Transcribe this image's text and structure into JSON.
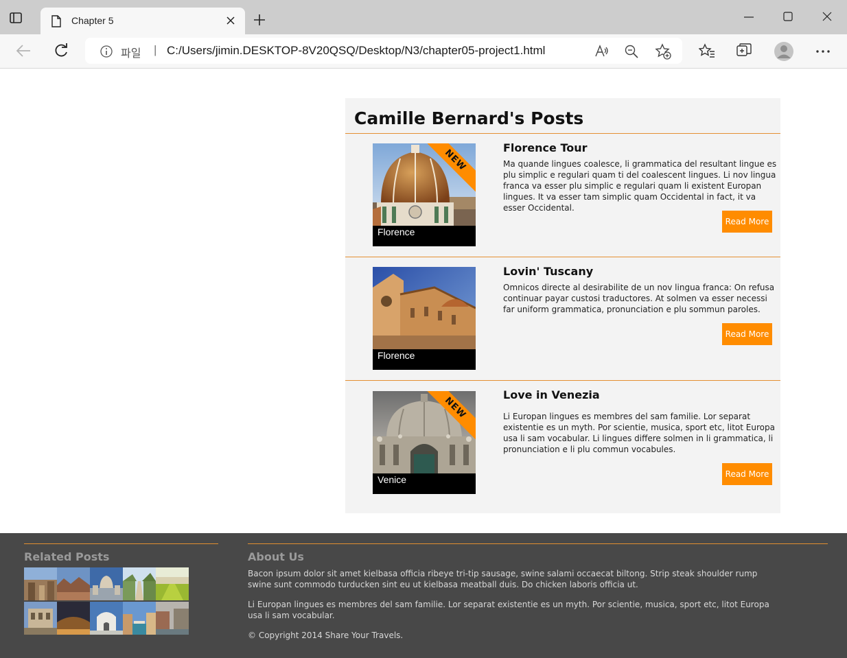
{
  "browser": {
    "tab_title": "Chapter 5",
    "address_prefix": "파일",
    "address_separator": "|",
    "url": "C:/Users/jimin.DESKTOP-8V20QSQ/Desktop/N3/chapter05-project1.html"
  },
  "posts": {
    "heading": "Camille Bernard's Posts",
    "items": [
      {
        "title": "Florence Tour",
        "text": "Ma quande lingues coalesce, li grammatica del resultant lingue es plu simplic e regulari quam ti del coalescent lingues. Li nov lingua franca va esser plu simplic e regulari quam li existent Europan lingues. It va esser tam simplic quam Occidental in fact, it va esser Occidental.",
        "caption": "Florence",
        "badge": "NEW",
        "button": "Read More"
      },
      {
        "title": "Lovin' Tuscany",
        "text": "Omnicos directe al desirabilite de un nov lingua franca: On refusa continuar payar custosi traductores. At solmen va esser necessi far uniform grammatica, pronunciation e plu sommun paroles.",
        "caption": "Florence",
        "button": "Read More"
      },
      {
        "title": "Love in Venezia",
        "text": "Li Europan lingues es membres del sam familie. Lor separat existentie es un myth. Por scientie, musica, sport etc, litot Europa usa li sam vocabular. Li lingues differe solmen in li grammatica, li pronunciation e li plu commun vocabules.",
        "caption": "Venice",
        "badge": "NEW",
        "button": "Read More"
      }
    ]
  },
  "footer": {
    "related_title": "Related Posts",
    "about_title": "About Us",
    "about_p1": "Bacon ipsum dolor sit amet kielbasa officia ribeye tri-tip sausage, swine salami occaecat biltong. Strip steak shoulder rump swine sunt commodo turducken sint eu ut kielbasa meatball duis. Do chicken laboris officia ut.",
    "about_p2": "Li Europan lingues es membres del sam familie. Lor separat existentie es un myth. Por scientie, musica, sport etc, litot Europa usa li sam vocabular.",
    "copyright": "© Copyright 2014 Share Your Travels."
  },
  "colors": {
    "accent": "#ff8c00",
    "footer_bg": "#484848",
    "panel_bg": "#f3f3f3"
  }
}
